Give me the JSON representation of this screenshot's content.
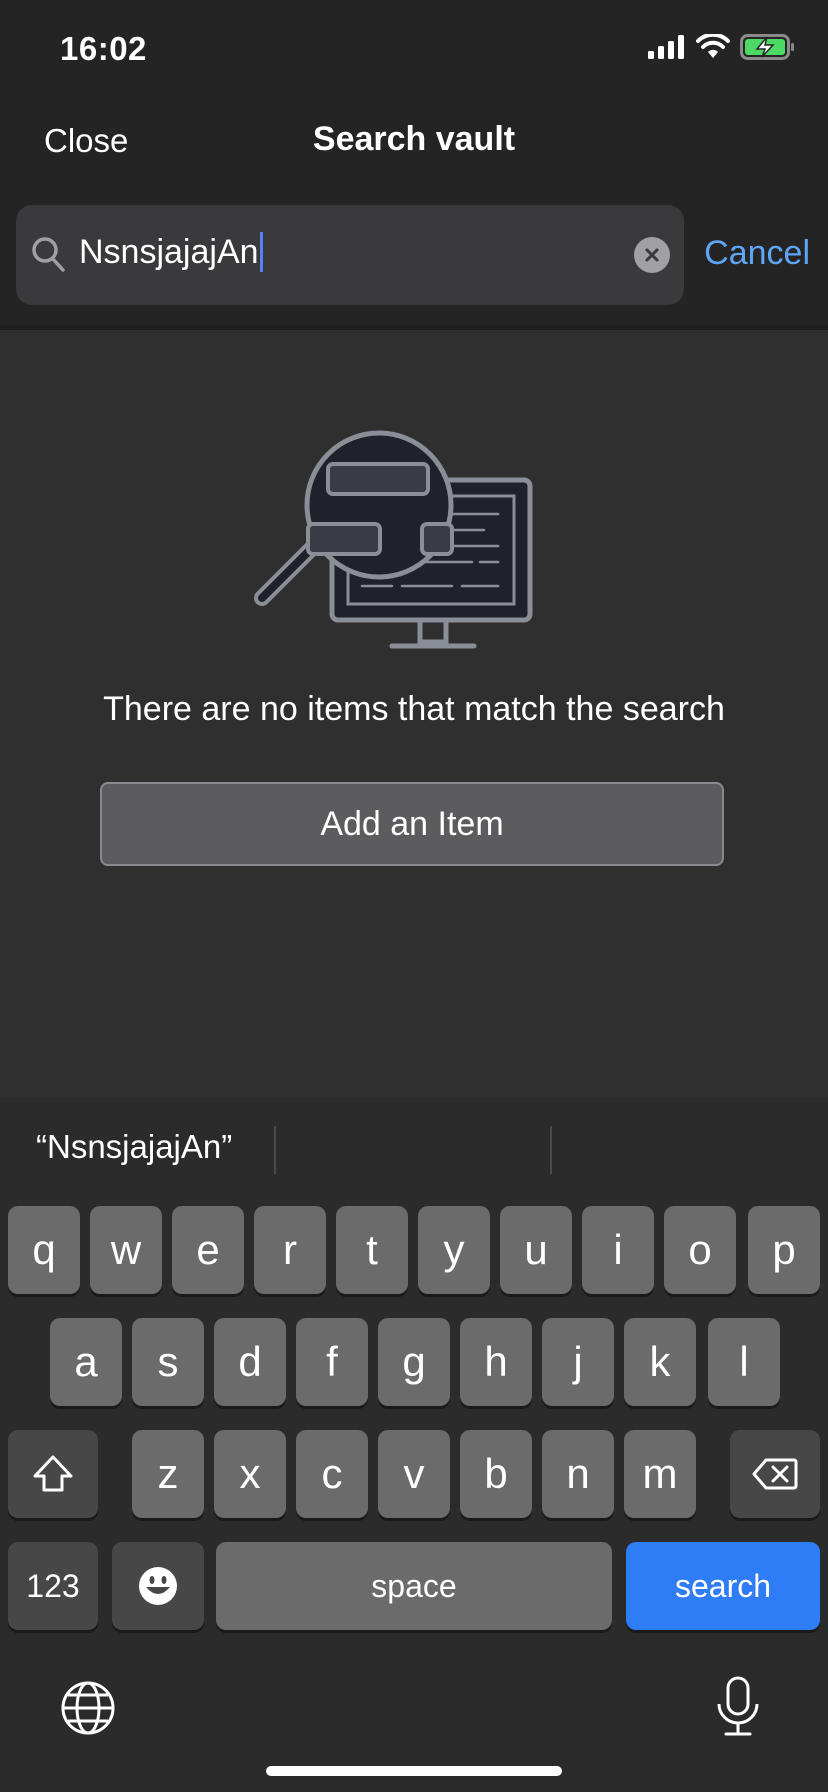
{
  "status_bar": {
    "time": "16:02"
  },
  "nav": {
    "close_label": "Close",
    "title": "Search vault",
    "cancel_label": "Cancel"
  },
  "search": {
    "value": "NsnsjajajAn"
  },
  "empty_state": {
    "message": "There are no items that match the search",
    "add_button_label": "Add an Item"
  },
  "keyboard": {
    "suggestion": "“NsnsjajajAn”",
    "row1": [
      "q",
      "w",
      "e",
      "r",
      "t",
      "y",
      "u",
      "i",
      "o",
      "p"
    ],
    "row2": [
      "a",
      "s",
      "d",
      "f",
      "g",
      "h",
      "j",
      "k",
      "l"
    ],
    "row3": [
      "z",
      "x",
      "c",
      "v",
      "b",
      "n",
      "m"
    ],
    "numbers_label": "123",
    "space_label": "space",
    "search_label": "search"
  },
  "colors": {
    "accent": "#5ea5f7",
    "search_key": "#2e7cf6",
    "battery": "#4cd964"
  }
}
